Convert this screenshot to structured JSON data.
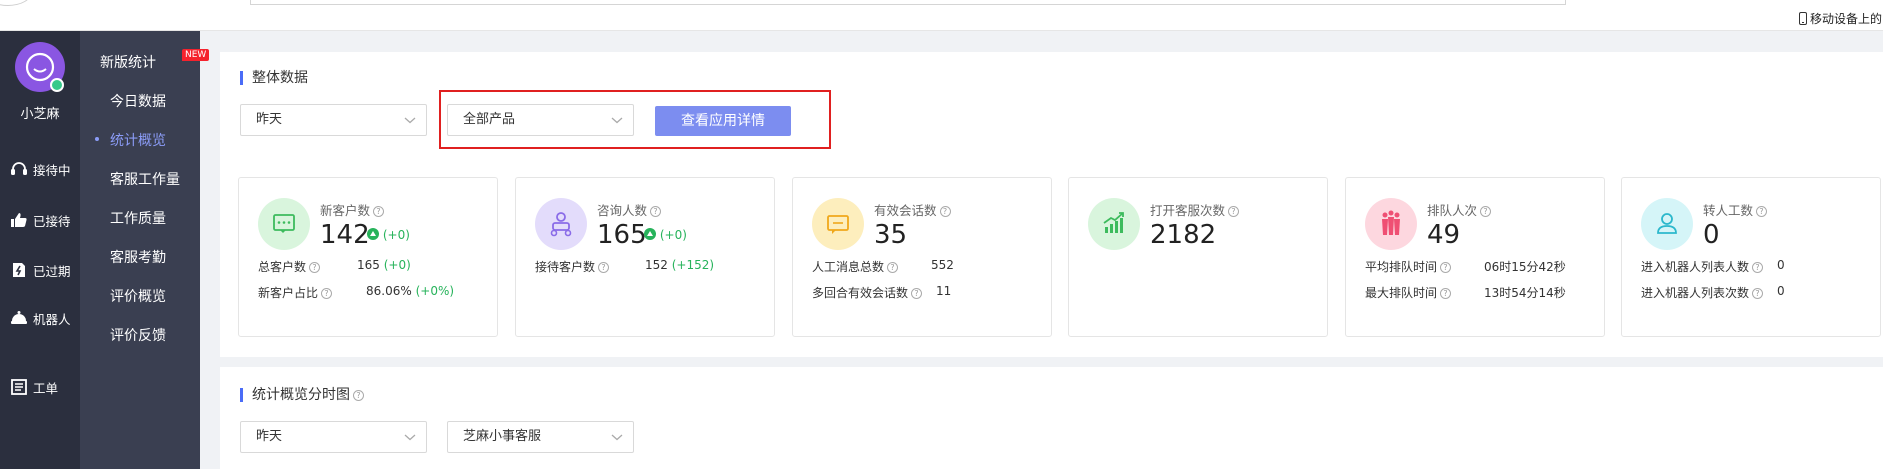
{
  "topbar": {
    "mobile_hint": "移动设备上的"
  },
  "sidebar": {
    "username": "小芝麻",
    "items": [
      {
        "label": "接待中",
        "icon": "headset-icon"
      },
      {
        "label": "已接待",
        "icon": "thumb-up-icon"
      },
      {
        "label": "已过期",
        "icon": "expired-icon"
      },
      {
        "label": "机器人",
        "icon": "robot-icon"
      },
      {
        "label": "工单",
        "icon": "ticket-icon"
      }
    ]
  },
  "subnav": {
    "header": "新版统计",
    "badge": "NEW",
    "items": [
      "今日数据",
      "统计概览",
      "客服工作量",
      "工作质量",
      "客服考勤",
      "评价概览",
      "评价反馈"
    ],
    "active": "统计概览"
  },
  "overview": {
    "title": "整体数据",
    "date_select": "昨天",
    "product_select": "全部产品",
    "view_button": "查看应用详情",
    "cards": [
      {
        "label": "新客户数",
        "value": "142",
        "trend": "(+0)",
        "icon": "chat-icon",
        "icon_bg": "#d9f5dd",
        "icon_color": "#3dbb5d",
        "rows": [
          {
            "label": "总客户数",
            "value": "165",
            "delta": "(+0)"
          },
          {
            "label": "新客户占比",
            "value": "86.06%",
            "delta": "(+0%)"
          }
        ]
      },
      {
        "label": "咨询人数",
        "value": "165",
        "trend": "(+0)",
        "icon": "group-icon",
        "icon_bg": "#e3dcfb",
        "icon_color": "#8a6be8",
        "rows": [
          {
            "label": "接待客户数",
            "value": "152",
            "delta": "(+152)"
          }
        ]
      },
      {
        "label": "有效会话数",
        "value": "35",
        "icon": "message-icon",
        "icon_bg": "#fdeebd",
        "icon_color": "#f0a81b",
        "rows": [
          {
            "label": "人工消息总数",
            "value": "552"
          },
          {
            "label": "多回合有效会话数",
            "value": "11"
          }
        ]
      },
      {
        "label": "打开客服次数",
        "value": "2182",
        "icon": "bar-chart-icon",
        "icon_bg": "#d9f5dd",
        "icon_color": "#3dbb5d",
        "rows": []
      },
      {
        "label": "排队人次",
        "value": "49",
        "icon": "queue-icon",
        "icon_bg": "#fdd7df",
        "icon_color": "#ef4f73",
        "rows": [
          {
            "label": "平均排队时间",
            "value": "06时15分42秒"
          },
          {
            "label": "最大排队时间",
            "value": "13时54分14秒"
          }
        ]
      },
      {
        "label": "转人工数",
        "value": "0",
        "icon": "user-icon",
        "icon_bg": "#d5f5f8",
        "icon_color": "#2bb8cc",
        "rows": [
          {
            "label": "进入机器人列表人数",
            "value": "0"
          },
          {
            "label": "进入机器人列表次数",
            "value": "0"
          }
        ]
      }
    ]
  },
  "timeline": {
    "title": "统计概览分时图",
    "date_select": "昨天",
    "service_select": "芝麻小事客服"
  }
}
